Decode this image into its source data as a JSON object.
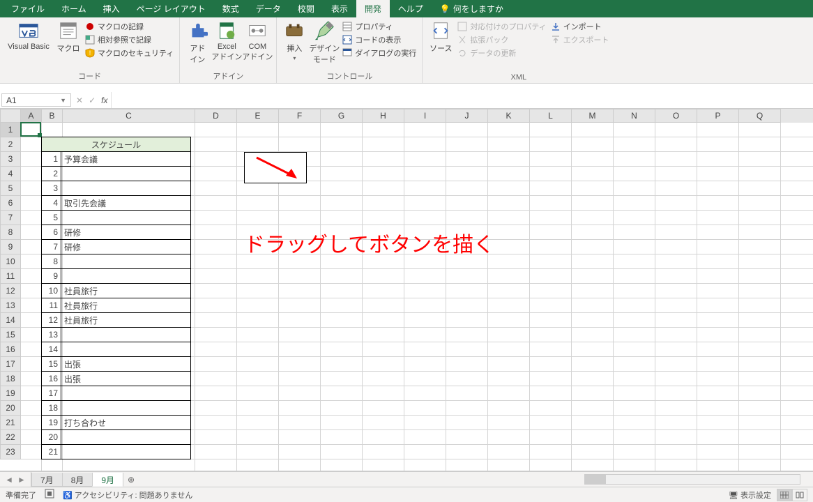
{
  "tabs": {
    "items": [
      "ファイル",
      "ホーム",
      "挿入",
      "ページ レイアウト",
      "数式",
      "データ",
      "校閲",
      "表示",
      "開発",
      "ヘルプ"
    ],
    "active": 8,
    "tellme": "何をしますか"
  },
  "ribbon": {
    "group1": {
      "vb": "Visual Basic",
      "macros": "マクロ",
      "rec": "マクロの記録",
      "rel": "相対参照で記録",
      "sec": "マクロのセキュリティ",
      "label": "コード"
    },
    "group2": {
      "addin": "アド\nイン",
      "excel": "Excel\nアドイン",
      "com": "COM\nアドイン",
      "label": "アドイン"
    },
    "group3": {
      "insert": "挿入",
      "design": "デザイン\nモード",
      "prop": "プロパティ",
      "code": "コードの表示",
      "run": "ダイアログの実行",
      "label": "コントロール"
    },
    "group4": {
      "source": "ソース",
      "map": "対応付けのプロパティ",
      "pack": "拡張パック",
      "refresh": "データの更新",
      "import": "インポート",
      "export": "エクスポート",
      "label": "XML"
    }
  },
  "namebox": "A1",
  "columns": [
    {
      "l": "A",
      "w": 30
    },
    {
      "l": "B",
      "w": 30
    },
    {
      "l": "C",
      "w": 190
    },
    {
      "l": "D",
      "w": 60
    },
    {
      "l": "E",
      "w": 60
    },
    {
      "l": "F",
      "w": 60
    },
    {
      "l": "G",
      "w": 60
    },
    {
      "l": "H",
      "w": 60
    },
    {
      "l": "I",
      "w": 60
    },
    {
      "l": "J",
      "w": 60
    },
    {
      "l": "K",
      "w": 60
    },
    {
      "l": "L",
      "w": 60
    },
    {
      "l": "M",
      "w": 60
    },
    {
      "l": "N",
      "w": 60
    },
    {
      "l": "O",
      "w": 60
    },
    {
      "l": "P",
      "w": 60
    },
    {
      "l": "Q",
      "w": 60
    }
  ],
  "visible_rows": 23,
  "table": {
    "header": "スケジュール",
    "rows": [
      {
        "n": 1,
        "t": "予算会議"
      },
      {
        "n": 2,
        "t": ""
      },
      {
        "n": 3,
        "t": ""
      },
      {
        "n": 4,
        "t": "取引先会議"
      },
      {
        "n": 5,
        "t": ""
      },
      {
        "n": 6,
        "t": "研修"
      },
      {
        "n": 7,
        "t": "研修"
      },
      {
        "n": 8,
        "t": ""
      },
      {
        "n": 9,
        "t": ""
      },
      {
        "n": 10,
        "t": "社員旅行"
      },
      {
        "n": 11,
        "t": "社員旅行"
      },
      {
        "n": 12,
        "t": "社員旅行"
      },
      {
        "n": 13,
        "t": ""
      },
      {
        "n": 14,
        "t": ""
      },
      {
        "n": 15,
        "t": "出張"
      },
      {
        "n": 16,
        "t": "出張"
      },
      {
        "n": 17,
        "t": ""
      },
      {
        "n": 18,
        "t": ""
      },
      {
        "n": 19,
        "t": "打ち合わせ"
      },
      {
        "n": 20,
        "t": ""
      },
      {
        "n": 21,
        "t": ""
      }
    ]
  },
  "annotation": "ドラッグしてボタンを描く",
  "sheets": {
    "items": [
      "7月",
      "8月",
      "9月"
    ],
    "active": 2
  },
  "status": {
    "ready": "準備完了",
    "acc": "アクセシビリティ: 問題ありません",
    "disp": "表示設定"
  }
}
